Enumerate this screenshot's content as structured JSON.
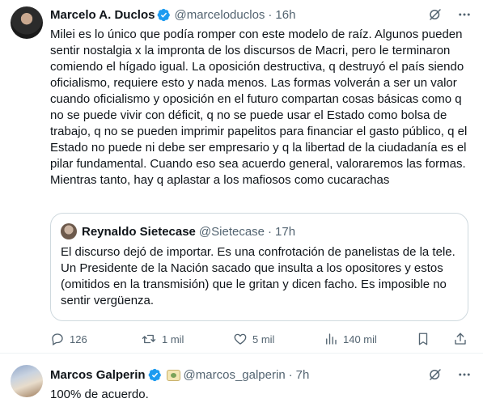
{
  "tweet": {
    "author": {
      "name": "Marcelo A. Duclos",
      "handle": "@marceloduclos",
      "time": "16h"
    },
    "text": "Milei es lo único que podía romper con este modelo de raíz. Algunos pueden sentir nostalgia x la impronta de los discursos de Macri, pero le terminaron comiendo el hígado igual. La oposición destructiva, q destruyó el país siendo oficialismo, requiere esto y nada menos. Las formas volverán a ser un valor cuando oficialismo y oposición en el futuro compartan cosas básicas como q no se puede vivir con déficit, q no se puede usar el Estado como bolsa de trabajo, q no se pueden imprimir papelitos para financiar el gasto público, q el Estado no puede ni debe ser empresario y q la libertad de la ciudadanía es el pilar fundamental. Cuando eso sea acuerdo general, valoraremos las formas. Mientras tanto, hay q aplastar a los mafiosos como cucarachas",
    "quote": {
      "name": "Reynaldo Sietecase",
      "handle": "@Sietecase",
      "time": "17h",
      "text": "El discurso dejó de importar. Es una confrotación de panelistas de la tele. Un Presidente de la Nación sacado que insulta a los opositores y estos (omitidos en la transmisión) que le gritan y dicen facho. Es imposible no sentir vergüenza."
    },
    "stats": {
      "replies": "126",
      "retweets": "1 mil",
      "likes": "5 mil",
      "views": "140 mil"
    }
  },
  "reply": {
    "author": {
      "name": "Marcos Galperin",
      "handle": "@marcos_galperin",
      "time": "7h"
    },
    "text": "100% de acuerdo."
  },
  "separator": "·",
  "icons": {
    "verified": "verified-badge-icon",
    "grok": "grok-icon",
    "more": "more-icon",
    "reply": "reply-icon",
    "retweet": "retweet-icon",
    "like": "like-icon",
    "views": "views-icon",
    "bookmark": "bookmark-icon",
    "share": "share-icon"
  },
  "colors": {
    "accent": "#1d9bf0",
    "muted": "#536471",
    "text": "#0f1419",
    "border": "#cfd9de"
  }
}
